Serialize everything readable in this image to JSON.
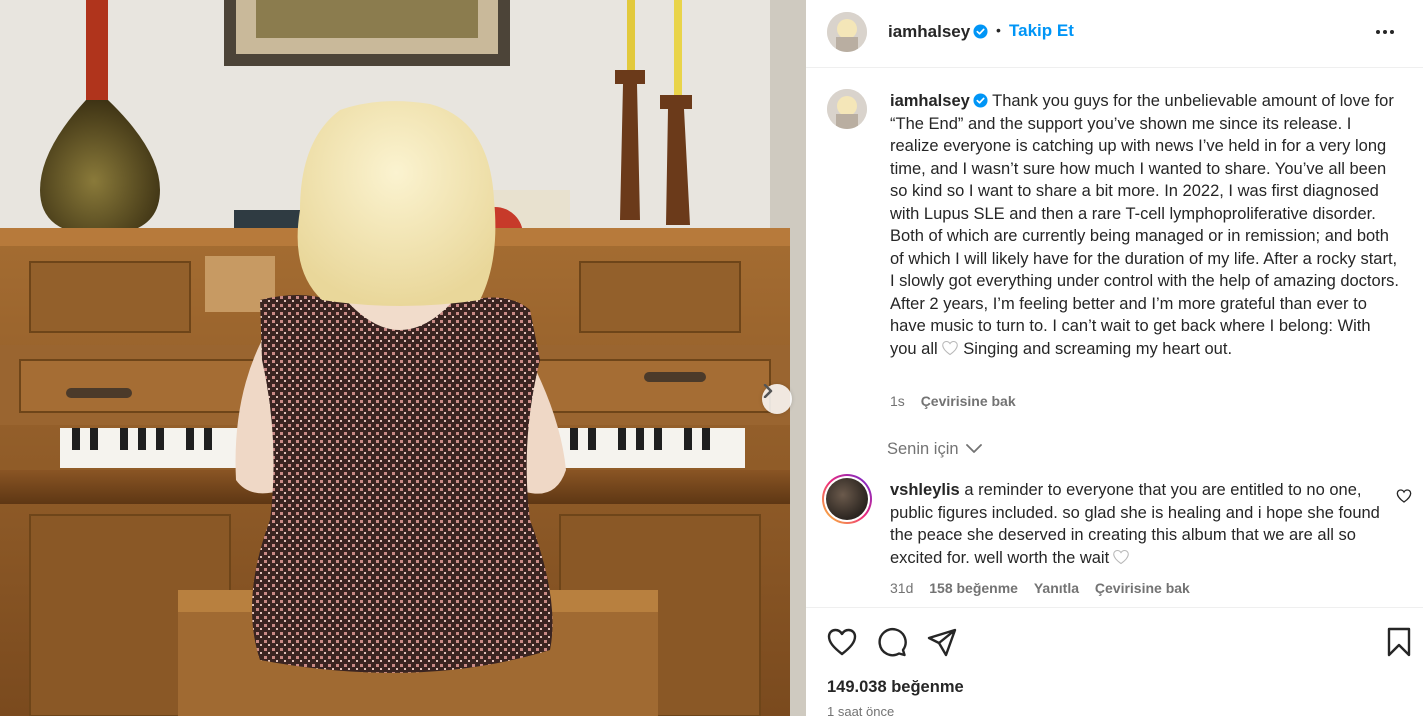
{
  "post": {
    "username": "iamhalsey",
    "follow_label": "Takip Et",
    "separator": "•",
    "caption_text": "Thank you guys for the unbelievable amount of love for “The End” and the support you’ve shown me since its release. I realize everyone is catching up with news I’ve held in for a very long time, and I wasn’t sure how much I wanted to share. You’ve all been so kind so I want to share a bit more. In 2022, I was first diagnosed with Lupus SLE and then a rare T-cell lymphoproliferative disorder. Both of which are currently being managed or in remission; and both of which I will likely have for the duration of my life. After a rocky start, I slowly got everything under control with the help of amazing doctors. After 2 years, I’m feeling better and I’m more grateful than ever to have music to turn to. I can’t wait to get back where I belong: With you all",
    "caption_text_end": "Singing and screaming my heart out.",
    "caption_age": "1s",
    "caption_translate": "Çevirisine bak",
    "likes_label": "149.038 beğenme",
    "posted_ago": "1 saat önce"
  },
  "comments_section": {
    "filter_label": "Senin için",
    "comments": [
      {
        "username": "vshleylis",
        "text": "a reminder to everyone that you are entitled to no one, public figures included. so glad she is healing and i hope she found the peace she deserved in creating this album that we are all so excited for. well worth the wait",
        "age": "31d",
        "likes": "158 beğenme",
        "reply_label": "Yanıtla",
        "translate_label": "Çevirisine bak"
      }
    ]
  },
  "icons": {
    "verified": "verified-badge-icon",
    "more": "more-options-icon",
    "carousel": "chevron-right-icon",
    "like": "heart-icon",
    "comment": "comment-icon",
    "share": "share-icon",
    "save": "bookmark-icon",
    "chevron": "chevron-down-icon"
  },
  "colors": {
    "accent": "#0095f6",
    "text": "#262626",
    "muted": "#737373",
    "divider": "#efefef"
  }
}
